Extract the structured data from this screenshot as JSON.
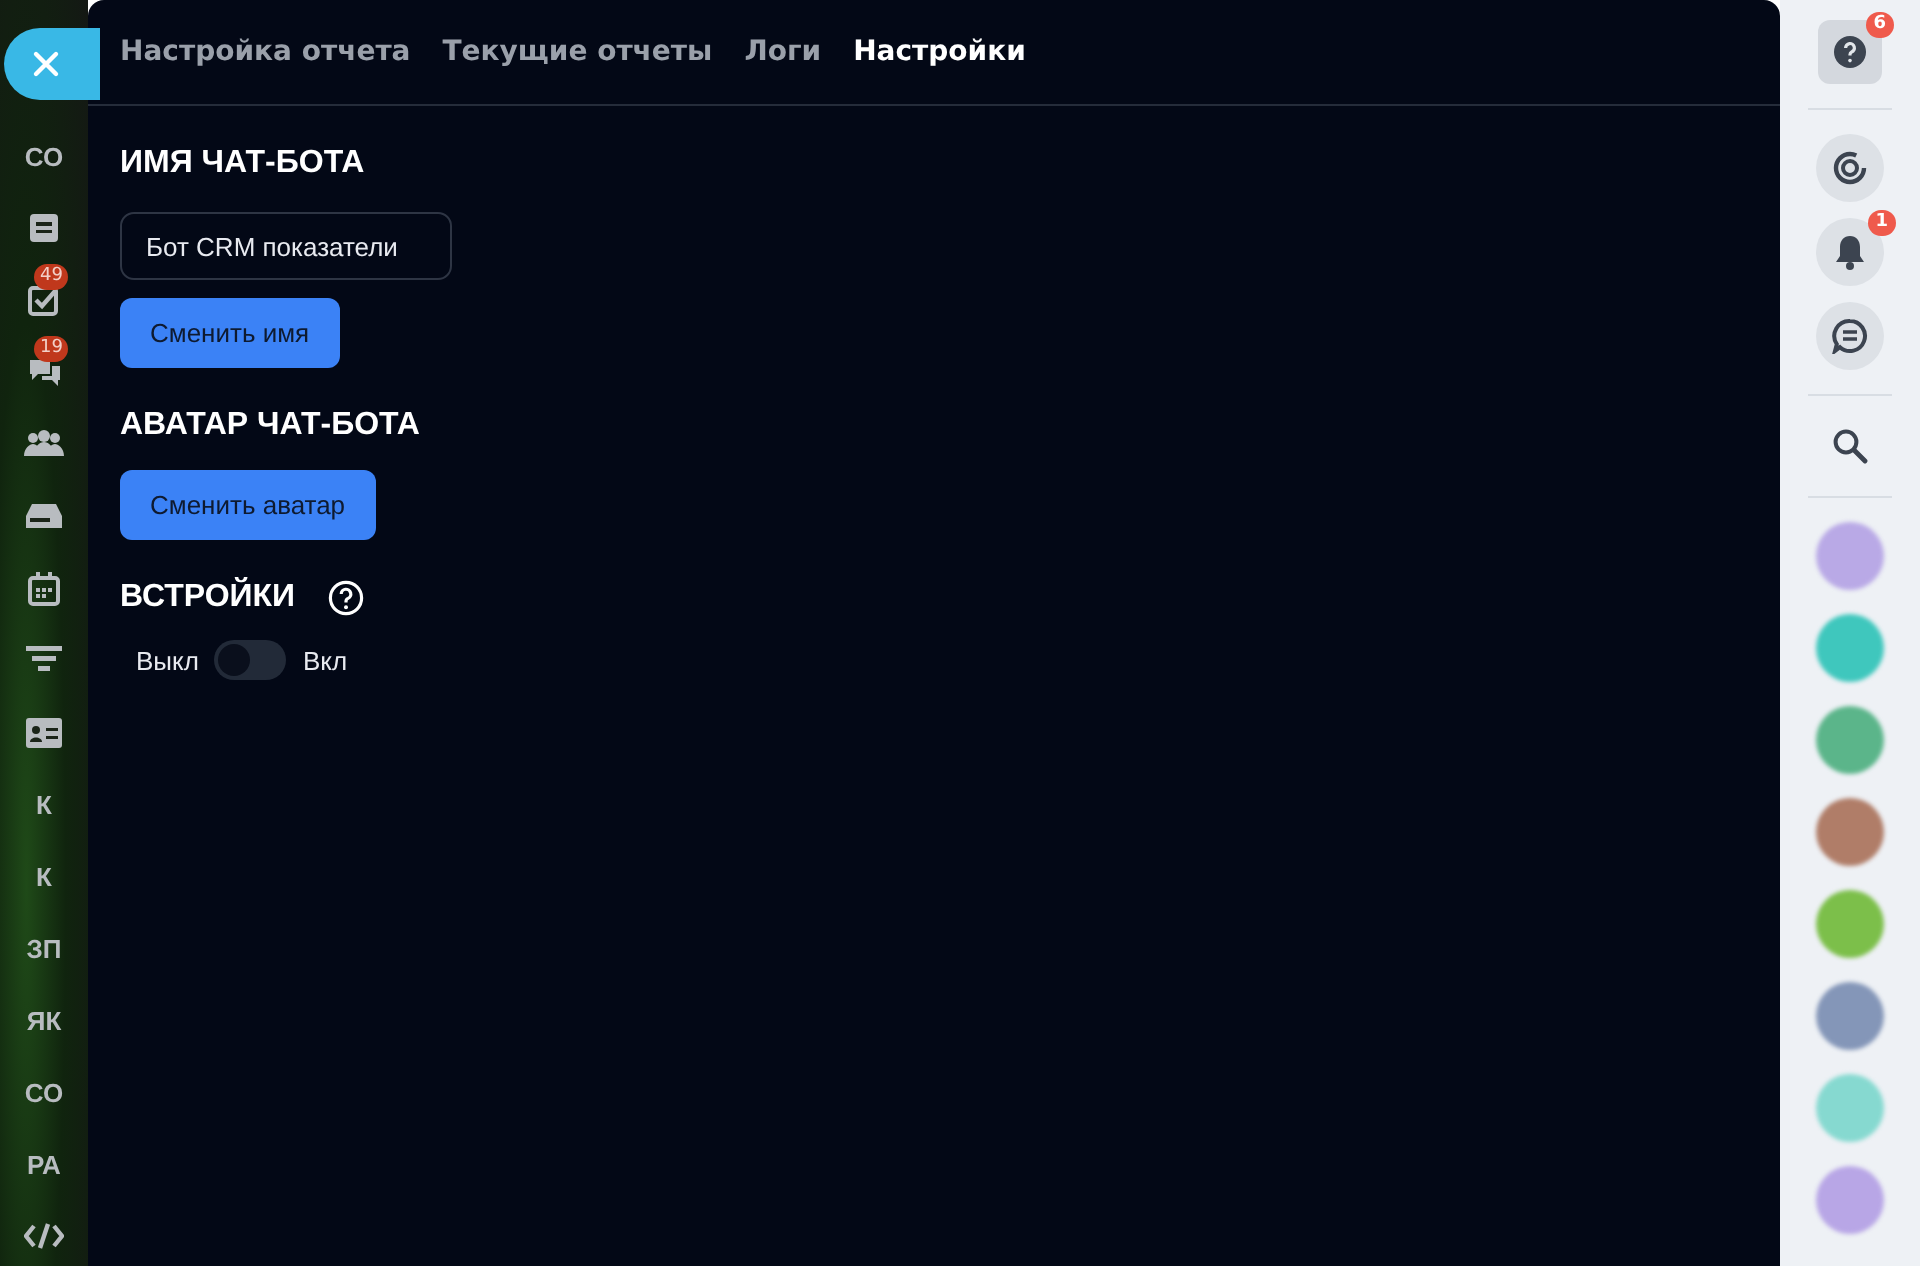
{
  "left_sidebar": {
    "items": [
      {
        "kind": "text",
        "label": "СО"
      },
      {
        "kind": "icon"
      },
      {
        "kind": "icon",
        "badge": "49"
      },
      {
        "kind": "icon",
        "badge": "19"
      },
      {
        "kind": "icon"
      },
      {
        "kind": "icon"
      },
      {
        "kind": "icon"
      },
      {
        "kind": "icon"
      },
      {
        "kind": "icon"
      },
      {
        "kind": "text",
        "label": "К"
      },
      {
        "kind": "text",
        "label": "К"
      },
      {
        "kind": "text",
        "label": "ЗП"
      },
      {
        "kind": "text",
        "label": "ЯК"
      },
      {
        "kind": "text",
        "label": "СО"
      },
      {
        "kind": "text",
        "label": "РА"
      },
      {
        "kind": "icon"
      }
    ]
  },
  "tabs": [
    {
      "label": "Настройка отчета",
      "selected": false
    },
    {
      "label": "Текущие отчеты",
      "selected": false
    },
    {
      "label": "Логи",
      "selected": false
    },
    {
      "label": "Настройки",
      "selected": true
    }
  ],
  "name_section": {
    "title": "ИМЯ ЧАТ-БОТА",
    "input_value": "Бот CRM показатели",
    "button": "Сменить имя"
  },
  "avatar_section": {
    "title": "АВАТАР ЧАТ-БОТА",
    "button": "Сменить аватар"
  },
  "embed_section": {
    "title": "ВСТРОЙКИ",
    "off_label": "Выкл",
    "on_label": "Вкл",
    "on": false
  },
  "right_sidebar": {
    "help_badge": "6",
    "bell_badge": "1",
    "avatars": [
      {
        "color": "#b9a9e6"
      },
      {
        "color": "#3fc7bd"
      },
      {
        "color": "#5bb58a"
      },
      {
        "color": "#b07d68"
      },
      {
        "color": "#7cbf4a"
      },
      {
        "color": "#8496b8"
      },
      {
        "color": "#86d9d0"
      },
      {
        "color": "#b8a6e6"
      }
    ]
  }
}
